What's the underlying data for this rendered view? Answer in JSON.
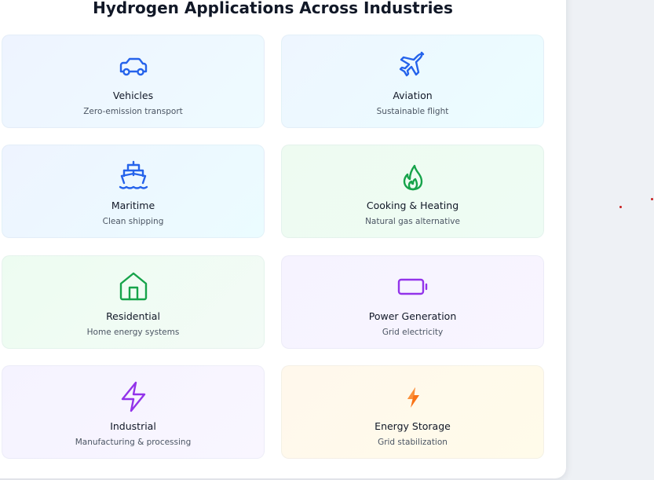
{
  "section": {
    "title": "Hydrogen Applications Across Industries"
  },
  "applications": [
    {
      "name": "Vehicles",
      "description": "Zero-emission transport",
      "icon": "car-icon",
      "color": "#2563eb"
    },
    {
      "name": "Aviation",
      "description": "Sustainable flight",
      "icon": "plane-icon",
      "color": "#2563eb"
    },
    {
      "name": "Maritime",
      "description": "Clean shipping",
      "icon": "ship-icon",
      "color": "#2563eb"
    },
    {
      "name": "Cooking & Heating",
      "description": "Natural gas alternative",
      "icon": "flame-icon",
      "color": "#16a34a"
    },
    {
      "name": "Residential",
      "description": "Home energy systems",
      "icon": "house-icon",
      "color": "#16a34a"
    },
    {
      "name": "Power Generation",
      "description": "Grid electricity",
      "icon": "battery-icon",
      "color": "#9333ea"
    },
    {
      "name": "Industrial",
      "description": "Manufacturing & processing",
      "icon": "lightning-icon",
      "color": "#9333ea"
    },
    {
      "name": "Energy Storage",
      "description": "Grid stabilization",
      "icon": "lightning-emoji-icon",
      "color": "#f97316"
    }
  ]
}
